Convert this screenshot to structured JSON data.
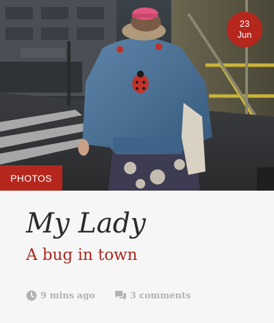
{
  "post": {
    "date": {
      "day": "23",
      "month": "Jun"
    },
    "category": "PHOTOS",
    "title": "My Lady",
    "subtitle": "A bug in town",
    "time_ago": "9 mins ago",
    "comments": "3 comments"
  },
  "colors": {
    "accent": "#b5261c",
    "subtitle": "#a8281e",
    "title": "#2b2b2b",
    "meta": "#b3b3b3",
    "background": "#f6f6f6"
  },
  "icons": {
    "time": "clock-icon",
    "comments": "comments-icon"
  }
}
